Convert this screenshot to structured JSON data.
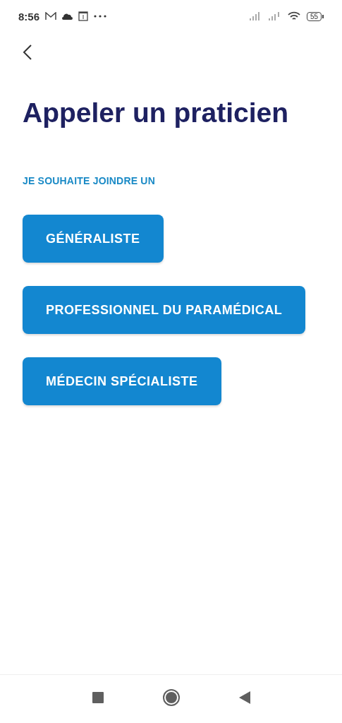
{
  "status_bar": {
    "time": "8:56",
    "battery": "55"
  },
  "title": "Appeler un praticien",
  "section_label": "JE SOUHAITE JOINDRE UN",
  "options": [
    {
      "label": "GÉNÉRALISTE"
    },
    {
      "label": "PROFESSIONNEL DU PARAMÉDICAL"
    },
    {
      "label": "MÉDECIN SPÉCIALISTE"
    }
  ]
}
